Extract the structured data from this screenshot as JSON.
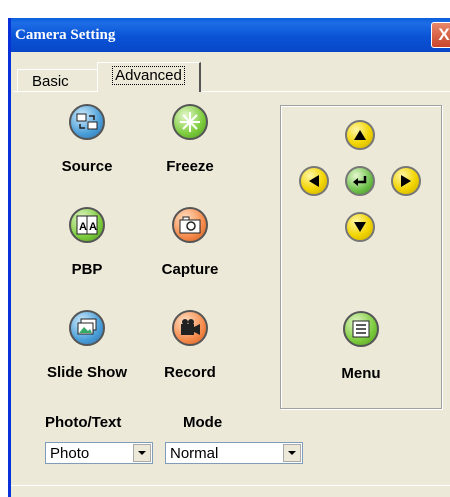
{
  "window": {
    "title": "Camera Setting",
    "close_label": "X"
  },
  "tabs": [
    {
      "label": "Basic"
    },
    {
      "label": "Advanced"
    }
  ],
  "tools": {
    "source": "Source",
    "freeze": "Freeze",
    "pbp": "PBP",
    "capture": "Capture",
    "slide_show": "Slide Show",
    "record": "Record",
    "menu": "Menu"
  },
  "icons": {
    "source": "source-icon",
    "freeze": "snowflake-icon",
    "pbp": "pbp-icon",
    "capture": "camera-icon",
    "slide_show": "slideshow-icon",
    "record": "video-camera-icon",
    "menu": "menu-icon",
    "up": "arrow-up-icon",
    "down": "arrow-down-icon",
    "left": "arrow-left-icon",
    "right": "arrow-right-icon",
    "enter": "enter-icon"
  },
  "controls": {
    "photo_text_label": "Photo/Text",
    "photo_text_value": "Photo",
    "mode_label": "Mode",
    "mode_value": "Normal"
  },
  "colors": {
    "titlebar": "#0a53d6",
    "window_bg": "#ece9d8",
    "nav_yellow": "#f2d500"
  }
}
